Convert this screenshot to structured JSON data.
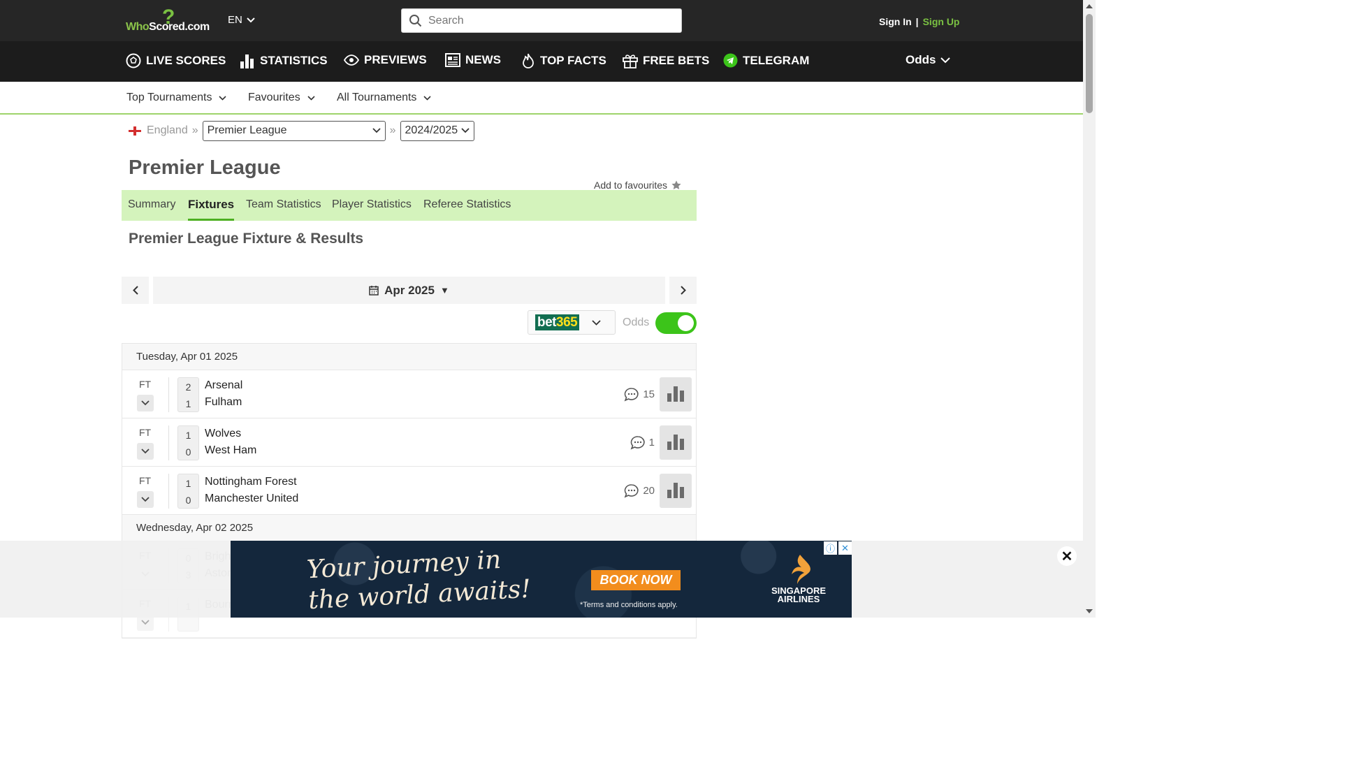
{
  "header": {
    "logo_text_a": "Who",
    "logo_text_b": "Scored",
    "logo_text_c": ".com",
    "lang": "EN",
    "search_placeholder": "Search",
    "sign_in": "Sign In",
    "separator": "|",
    "sign_up": "Sign Up"
  },
  "nav": {
    "live_scores": "LIVE SCORES",
    "statistics": "STATISTICS",
    "previews": "PREVIEWS",
    "news": "NEWS",
    "top_facts": "TOP FACTS",
    "free_bets": "FREE BETS",
    "telegram": "TELEGRAM",
    "odds": "Odds"
  },
  "subnav": {
    "top_tournaments": "Top Tournaments",
    "favourites": "Favourites",
    "all_tournaments": "All Tournaments"
  },
  "breadcrumb": {
    "country": "England",
    "sep": "»",
    "league": "Premier League",
    "season": "2024/2025"
  },
  "page": {
    "title": "Premier League",
    "add_favourites": "Add to favourites",
    "subheading": "Premier League Fixture & Results"
  },
  "tabs": [
    "Summary",
    "Fixtures",
    "Team Statistics",
    "Player Statistics",
    "Referee Statistics"
  ],
  "month_picker": {
    "label": "Apr 2025",
    "caret": "▼"
  },
  "odds_bar": {
    "bookmaker_a": "bet",
    "bookmaker_b": "365",
    "odds_label": "Odds",
    "odds_on": true
  },
  "days": [
    {
      "date": "Tuesday, Apr 01 2025",
      "matches": [
        {
          "status": "FT",
          "home": "Arsenal",
          "away": "Fulham",
          "home_score": "2",
          "away_score": "1",
          "comments": "15"
        },
        {
          "status": "FT",
          "home": "Wolves",
          "away": "West Ham",
          "home_score": "1",
          "away_score": "0",
          "comments": "1"
        },
        {
          "status": "FT",
          "home": "Nottingham Forest",
          "away": "Manchester United",
          "home_score": "1",
          "away_score": "0",
          "comments": "20"
        }
      ]
    },
    {
      "date": "Wednesday, Apr 02 2025",
      "matches": [
        {
          "status": "FT",
          "home": "Brigh",
          "away": "Aston",
          "home_score": "0",
          "away_score": "3",
          "comments": ""
        },
        {
          "status": "FT",
          "home": "Bourn",
          "away": "",
          "home_score": "1",
          "away_score": "",
          "comments": ""
        }
      ]
    }
  ],
  "ad": {
    "line1": "Your journey in",
    "line2": "the world awaits!",
    "cta": "BOOK NOW",
    "terms": "*Terms and conditions apply.",
    "brand_line1": "SINGAPORE",
    "brand_line2": "AIRLINES",
    "info": "ⓘ",
    "x": "✕",
    "close": "✕"
  }
}
